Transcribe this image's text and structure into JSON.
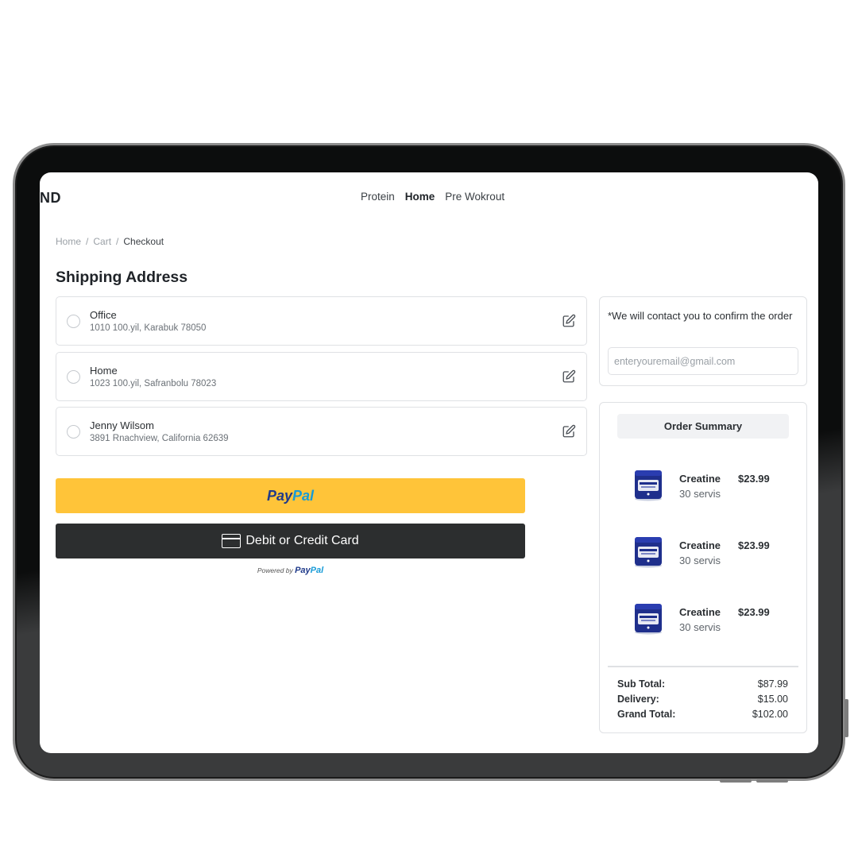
{
  "header": {
    "brand": "ND",
    "nav": [
      {
        "label": "Protein",
        "active": false
      },
      {
        "label": "Home",
        "active": true
      },
      {
        "label": "Pre Wokrout",
        "active": false
      }
    ]
  },
  "breadcrumb": {
    "items": [
      "Home",
      "Cart",
      "Checkout"
    ],
    "separator": "/"
  },
  "shipping": {
    "title": "Shipping Address",
    "addresses": [
      {
        "name": "Office",
        "address": "1010 100.yil, Karabuk 78050"
      },
      {
        "name": "Home",
        "address": "1023 100.yil, Safranbolu 78023"
      },
      {
        "name": "Jenny Wilsom",
        "address": "3891 Rnachview, California 62639"
      }
    ]
  },
  "payment": {
    "paypal_part1": "Pay",
    "paypal_part2": "Pal",
    "card_label": "Debit or Credit Card",
    "powered_by": "Powered by",
    "powered_brand_part1": "Pay",
    "powered_brand_part2": "Pal",
    "paypal_color": "#ffc439",
    "card_button_color": "#2c2e2f"
  },
  "contact": {
    "note": "*We will contact you to confirm the order",
    "email_placeholder": "enteryouremail@gmail.com"
  },
  "order_summary": {
    "title": "Order Summary",
    "items": [
      {
        "name": "Creatine",
        "subtitle": "30 servis",
        "price": "$23.99",
        "icon": "creatine-jar-icon"
      },
      {
        "name": "Creatine",
        "subtitle": "30 servis",
        "price": "$23.99",
        "icon": "creatine-jar-icon"
      },
      {
        "name": "Creatine",
        "subtitle": "30 servis",
        "price": "$23.99",
        "icon": "creatine-jar-icon"
      }
    ],
    "totals": [
      {
        "label": "Sub Total:",
        "value": "$87.99"
      },
      {
        "label": "Delivery:",
        "value": "$15.00"
      },
      {
        "label": "Grand Total:",
        "value": "$102.00"
      }
    ]
  }
}
